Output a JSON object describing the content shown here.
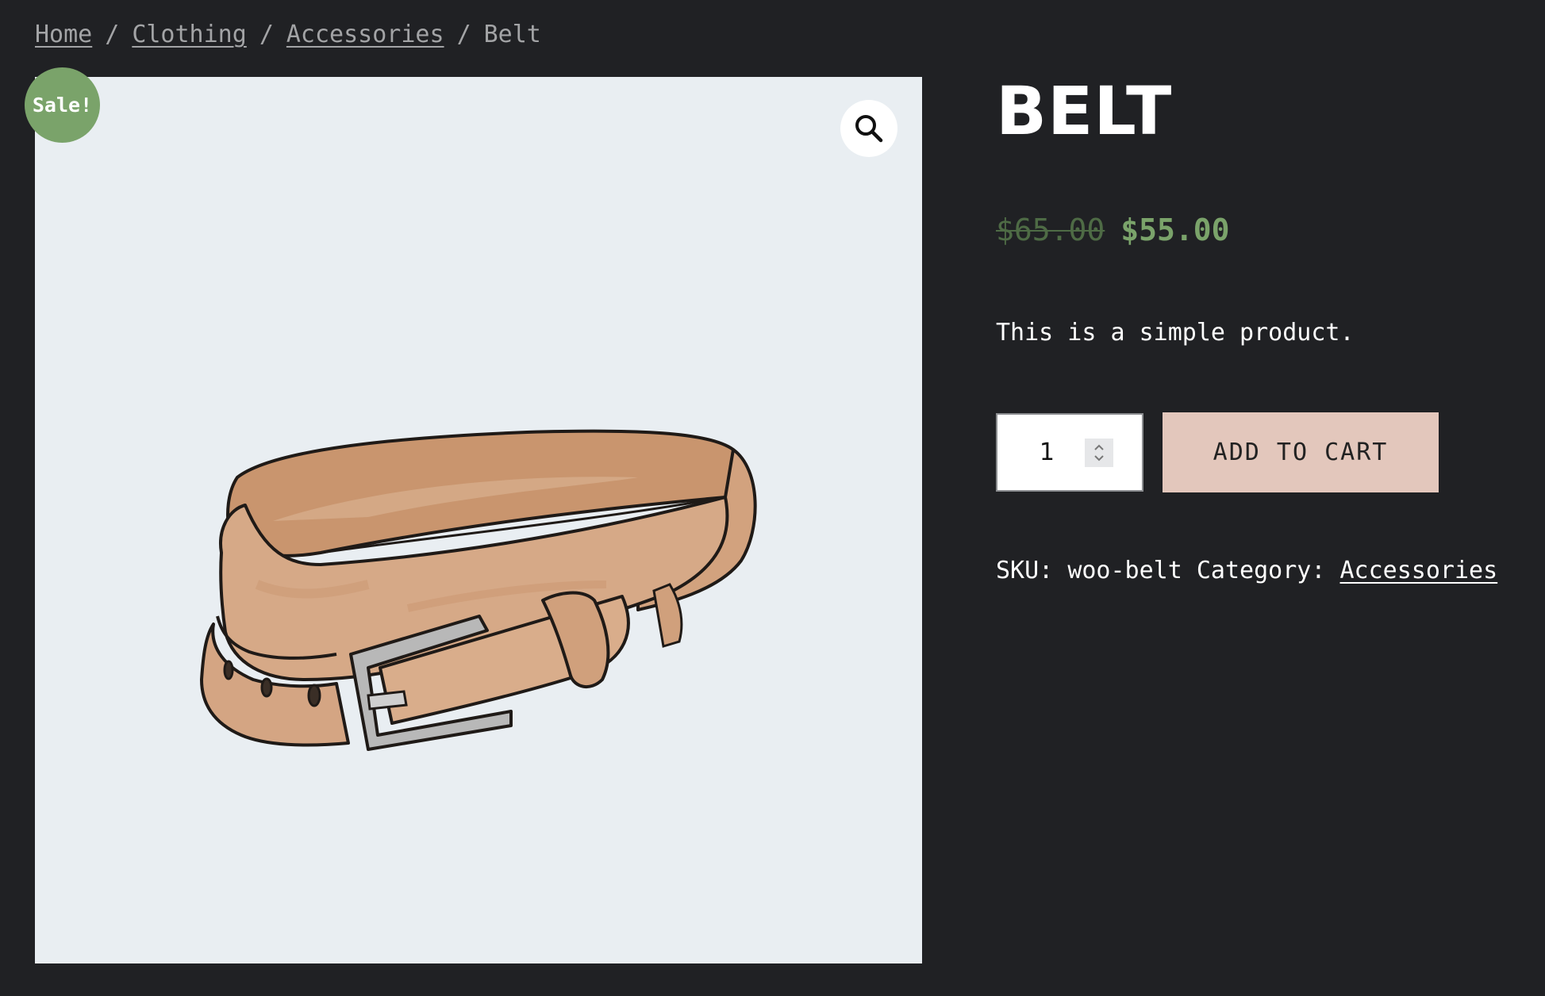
{
  "breadcrumb": {
    "items": [
      {
        "label": "Home"
      },
      {
        "label": "Clothing"
      },
      {
        "label": "Accessories"
      }
    ],
    "separator": "/",
    "current": "Belt"
  },
  "gallery": {
    "sale_badge": "Sale!",
    "zoom_icon": "search-icon",
    "image_subject": "belt"
  },
  "product": {
    "title": "BELT",
    "price_regular": "$65.00",
    "price_sale": "$55.00",
    "short_description": "This is a simple product.",
    "quantity": "1",
    "add_to_cart_label": "ADD TO CART",
    "sku_label": "SKU:",
    "sku": "woo-belt",
    "category_label": "Category:",
    "category": "Accessories"
  },
  "colors": {
    "background": "#202124",
    "sale_badge": "#7aa36a",
    "sale_price": "#7aa36a",
    "add_to_cart_bg": "#e3c7bc",
    "image_bg": "#e9eef2"
  }
}
